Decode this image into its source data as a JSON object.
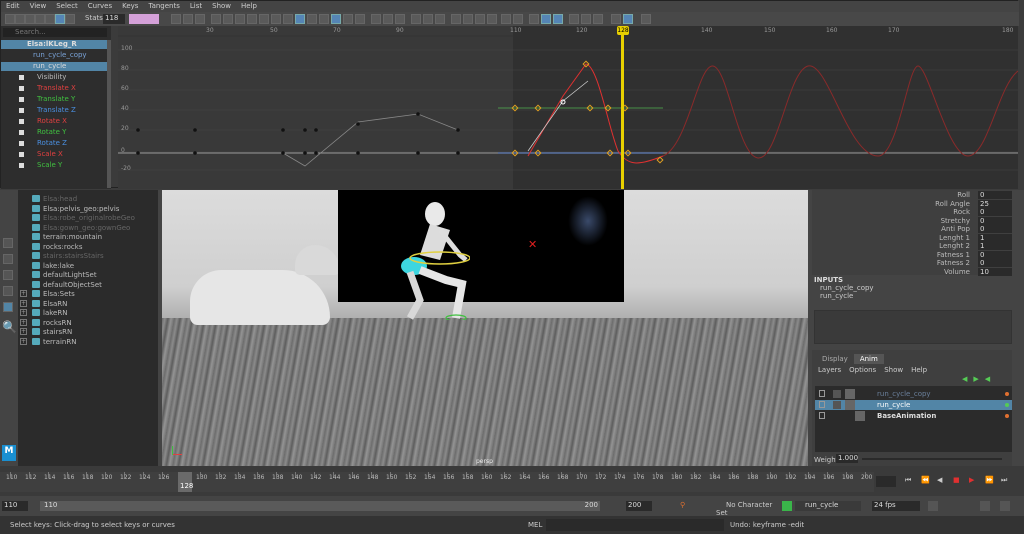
{
  "graph_editor": {
    "menu": [
      "Edit",
      "View",
      "Select",
      "Curves",
      "Keys",
      "Tangents",
      "List",
      "Show",
      "Help"
    ],
    "stats_label": "Stats",
    "stats_value1": "118",
    "stats_value2": "",
    "search_placeholder": "Search...",
    "outline": [
      {
        "label": "Elsa:lKLeg_R",
        "sel": true,
        "color": "#ddd"
      },
      {
        "label": "run_cycle_copy",
        "sel": false,
        "color": "#7aa3d8"
      },
      {
        "label": "run_cycle",
        "sel": true,
        "color": "#ddd"
      },
      {
        "label": "Visibility",
        "color": "#bbb"
      },
      {
        "label": "Translate X",
        "color": "#e04040"
      },
      {
        "label": "Translate Y",
        "color": "#40c040"
      },
      {
        "label": "Translate Z",
        "color": "#4a8fe0"
      },
      {
        "label": "Rotate X",
        "color": "#e04040"
      },
      {
        "label": "Rotate Y",
        "color": "#40c040"
      },
      {
        "label": "Rotate Z",
        "color": "#4a8fe0"
      },
      {
        "label": "Scale X",
        "color": "#e04040"
      },
      {
        "label": "Scale Y",
        "color": "#40c040"
      }
    ],
    "ruler_labels": [
      "30",
      "50",
      "70",
      "90",
      "110",
      "120",
      "128",
      "140",
      "150",
      "160",
      "170",
      "180"
    ],
    "y_labels": [
      "100",
      "80",
      "60",
      "40",
      "20",
      "0",
      "-20"
    ],
    "current_frame": "128"
  },
  "outliner": {
    "items": [
      {
        "label": "Elsa:head",
        "dim": true
      },
      {
        "label": "Elsa:pelvis_geo:pelvis",
        "dim": false
      },
      {
        "label": "Elsa:robe_originalrobeGeo",
        "dim": true
      },
      {
        "label": "Elsa:gown_geo:gownGeo",
        "dim": true
      },
      {
        "label": "terrain:mountain",
        "dim": false
      },
      {
        "label": "rocks:rocks",
        "dim": false
      },
      {
        "label": "stairs:stairsStairs",
        "dim": true
      },
      {
        "label": "lake:lake",
        "dim": false
      },
      {
        "label": "defaultLightSet",
        "dim": false
      },
      {
        "label": "defaultObjectSet",
        "dim": false
      },
      {
        "label": "Elsa:Sets",
        "dim": false
      },
      {
        "label": "ElsaRN",
        "dim": false
      },
      {
        "label": "lakeRN",
        "dim": false
      },
      {
        "label": "rocksRN",
        "dim": false
      },
      {
        "label": "stairsRN",
        "dim": false
      },
      {
        "label": "terrainRN",
        "dim": false
      }
    ]
  },
  "viewport": {
    "camera_label": "persp"
  },
  "channel_box": {
    "attrs": [
      {
        "name": "Roll",
        "value": "0"
      },
      {
        "name": "Roll Angle",
        "value": "25"
      },
      {
        "name": "Rock",
        "value": "0"
      },
      {
        "name": "Stretchy",
        "value": "0"
      },
      {
        "name": "Anti Pop",
        "value": "0"
      },
      {
        "name": "Lenght 1",
        "value": "1"
      },
      {
        "name": "Lenght 2",
        "value": "1"
      },
      {
        "name": "Fatness 1",
        "value": "0"
      },
      {
        "name": "Fatness 2",
        "value": "0"
      },
      {
        "name": "Volume",
        "value": "10"
      }
    ],
    "inputs_title": "INPUTS",
    "inputs": [
      "run_cycle_copy",
      "run_cycle"
    ]
  },
  "layer_editor": {
    "tabs": [
      "Display",
      "Anim"
    ],
    "menu": [
      "Layers",
      "Options",
      "Show",
      "Help"
    ],
    "layers": [
      {
        "label": "run_cycle_copy",
        "dim": true
      },
      {
        "label": "run_cycle",
        "sel": true
      },
      {
        "label": "BaseAnimation"
      }
    ],
    "weight_label": "Weight",
    "weight_value": "1.000"
  },
  "time_slider": {
    "labels": [
      "110",
      "112",
      "114",
      "116",
      "118",
      "120",
      "122",
      "124",
      "126",
      "128",
      "130",
      "132",
      "134",
      "136",
      "138",
      "140",
      "142",
      "144",
      "146",
      "148",
      "150",
      "152",
      "154",
      "156",
      "158",
      "160",
      "162",
      "164",
      "166",
      "168",
      "170",
      "172",
      "174",
      "176",
      "178",
      "180",
      "182",
      "184",
      "186",
      "188",
      "190",
      "192",
      "194",
      "196",
      "198",
      "200"
    ],
    "current": "128",
    "end_field": "200"
  },
  "range_slider": {
    "start": "110",
    "inner_start": "110",
    "inner_end": "200",
    "end": "200",
    "character_set": "No Character Set",
    "anim_layer": "run_cycle",
    "fps": "24 fps"
  },
  "status": {
    "help": "Select keys: Click-drag to select keys or curves",
    "mel": "MEL",
    "undo": "Undo: keyframe -edit"
  },
  "colors": {
    "accent": "#5285a6",
    "timecursor": "#e8d000",
    "select": "#5285a6"
  }
}
